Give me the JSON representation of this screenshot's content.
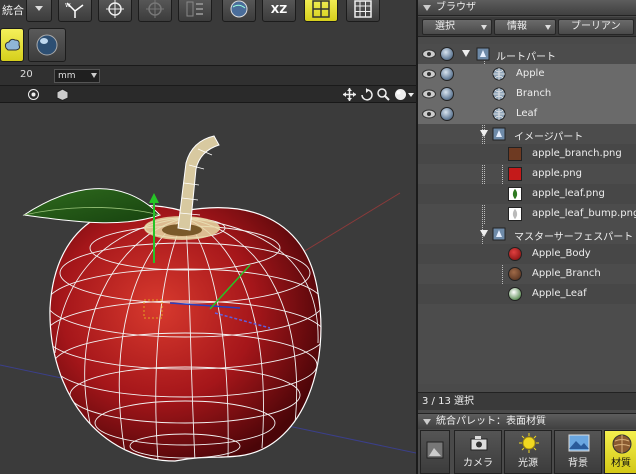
{
  "toolbar": {
    "mode_label": "統合",
    "xz_label": "XZ"
  },
  "numeric": {
    "value": "20",
    "unit": "mm"
  },
  "browser": {
    "title": "ブラウザ",
    "tabs": [
      "選択",
      "情報",
      "ブーリアン"
    ],
    "tree": [
      {
        "label": "ルートパート",
        "type": "part"
      },
      {
        "label": "Apple",
        "type": "object"
      },
      {
        "label": "Branch",
        "type": "object"
      },
      {
        "label": "Leaf",
        "type": "object"
      },
      {
        "label": "イメージパート",
        "type": "part"
      },
      {
        "label": "apple_branch.png",
        "type": "image"
      },
      {
        "label": "apple.png",
        "type": "image"
      },
      {
        "label": "apple_leaf.png",
        "type": "image"
      },
      {
        "label": "apple_leaf_bump.png",
        "type": "image"
      },
      {
        "label": "マスターサーフェスパート",
        "type": "part"
      },
      {
        "label": "Apple_Body",
        "type": "surface"
      },
      {
        "label": "Apple_Branch",
        "type": "surface"
      },
      {
        "label": "Apple_Leaf",
        "type": "surface"
      }
    ],
    "status": "3 / 13 選択"
  },
  "palette": {
    "title": "統合パレット：表面材質",
    "items": [
      "カメラ",
      "光源",
      "背景",
      "材質"
    ]
  },
  "colors": {
    "accent_yellow": "#e8e02a",
    "panel_bg": "#4a4a4a",
    "apple_red": "#b01818"
  }
}
